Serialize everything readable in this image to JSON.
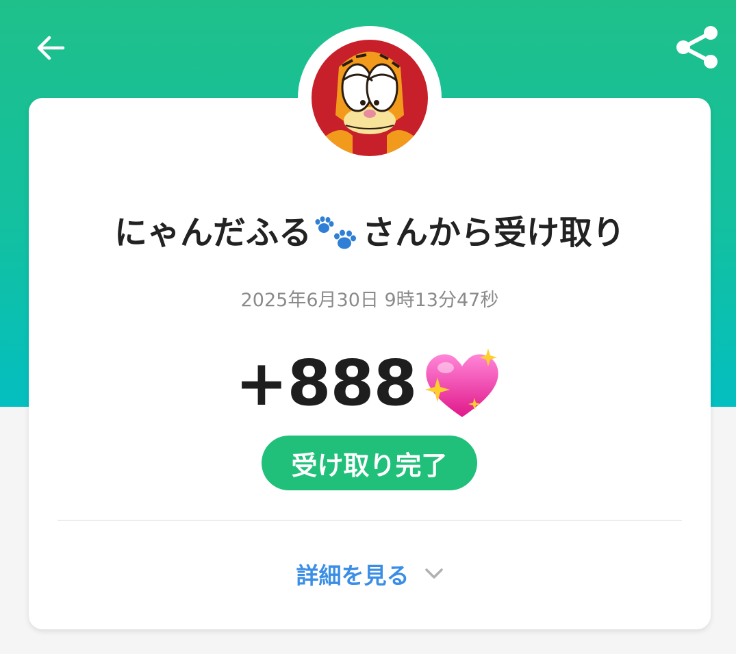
{
  "header": {
    "back_icon": "arrow-left-icon",
    "share_icon": "share-icon",
    "accent_color": "#1fc08a"
  },
  "receipt": {
    "sender_name": "にゃんだふる",
    "title_suffix": "さんから受け取り",
    "timestamp": "2025年6月30日 9時13分47秒",
    "amount": "+888",
    "amount_emoji": "sparkling-heart-icon",
    "status": "受け取り完了",
    "status_color": "#20c07a"
  },
  "details": {
    "label": "詳細を見る",
    "chevron_icon": "chevron-down-icon",
    "link_color": "#3a8ee6"
  }
}
